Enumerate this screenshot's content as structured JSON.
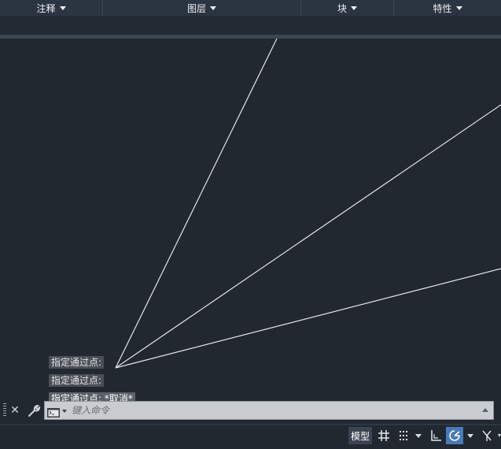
{
  "ribbon": {
    "groups": [
      {
        "label": "注释"
      },
      {
        "label": "图层"
      },
      {
        "label": "块"
      },
      {
        "label": "特性"
      }
    ]
  },
  "drawing": {
    "line_color": "#e6e6e6",
    "background": "#212830"
  },
  "command_history": [
    "指定通过点:",
    "指定通过点:",
    "指定通过点: *取消*"
  ],
  "command_bar": {
    "placeholder": "键入命令",
    "close_icon": "close-icon",
    "customize_icon": "wrench-icon",
    "prompt_icon": "command-prompt-icon"
  },
  "status_bar": {
    "model_label": "模型",
    "icons": [
      "grid-icon",
      "snap-grid-icon",
      "dropdown-icon",
      "ortho-icon",
      "polar-tracking-icon",
      "dropdown-icon",
      "isodraft-icon"
    ],
    "active_color": "#4a7ab8"
  }
}
